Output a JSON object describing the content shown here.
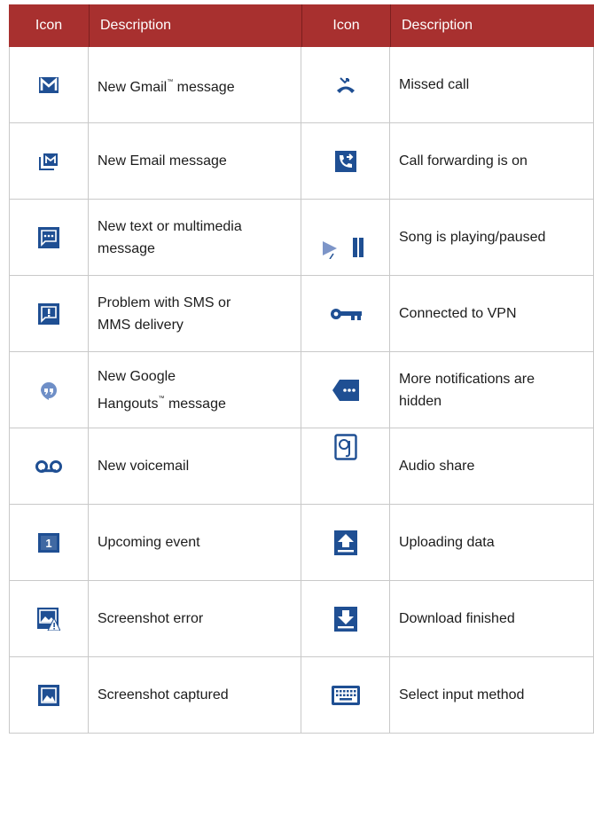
{
  "header": {
    "left_icon": "Icon",
    "left_desc": "Description",
    "right_icon": "Icon",
    "right_desc": "Description"
  },
  "rows": [
    {
      "left": {
        "icon": "gmail-icon",
        "line1": "New Gmail",
        "tm": "™",
        "line1b": " message"
      },
      "right": {
        "icon": "missed-call-icon",
        "text": "Missed call"
      }
    },
    {
      "left": {
        "icon": "email-icon",
        "text": "New Email message"
      },
      "right": {
        "icon": "call-forwarding-icon",
        "text": "Call forwarding is on"
      }
    },
    {
      "left": {
        "icon": "text-message-icon",
        "line1": "New text or  multimedia",
        "line2": "message"
      },
      "right": {
        "icon": "play-pause-icon",
        "text": "Song is playing/paused"
      }
    },
    {
      "left": {
        "icon": "sms-problem-icon",
        "line1": "Problem with SMS or",
        "line2": "MMS delivery"
      },
      "right": {
        "icon": "vpn-key-icon",
        "text": "Connected to VPN"
      }
    },
    {
      "left": {
        "icon": "hangouts-icon",
        "line1": "New Google",
        "line2a": "Hangouts",
        "tm": "™",
        "line2b": " message"
      },
      "right": {
        "icon": "more-notifications-icon",
        "line1": "More notifications  are",
        "line2": "hidden"
      }
    },
    {
      "left": {
        "icon": "voicemail-icon",
        "text": "New voicemail"
      },
      "right": {
        "icon": "audio-share-icon",
        "text": "Audio share"
      }
    },
    {
      "left": {
        "icon": "calendar-icon",
        "text": "Upcoming event"
      },
      "right": {
        "icon": "upload-icon",
        "text": "Uploading data"
      }
    },
    {
      "left": {
        "icon": "screenshot-error-icon",
        "text": "Screenshot error"
      },
      "right": {
        "icon": "download-icon",
        "text": "Download finished"
      }
    },
    {
      "left": {
        "icon": "screenshot-icon",
        "text": "Screenshot captured"
      },
      "right": {
        "icon": "keyboard-icon",
        "text": "Select input method"
      }
    }
  ],
  "colors": {
    "header_bg": "#a8302f",
    "icon_blue": "#1f4f93",
    "grid_line": "#c9c9c9"
  },
  "calendar_number": "1"
}
